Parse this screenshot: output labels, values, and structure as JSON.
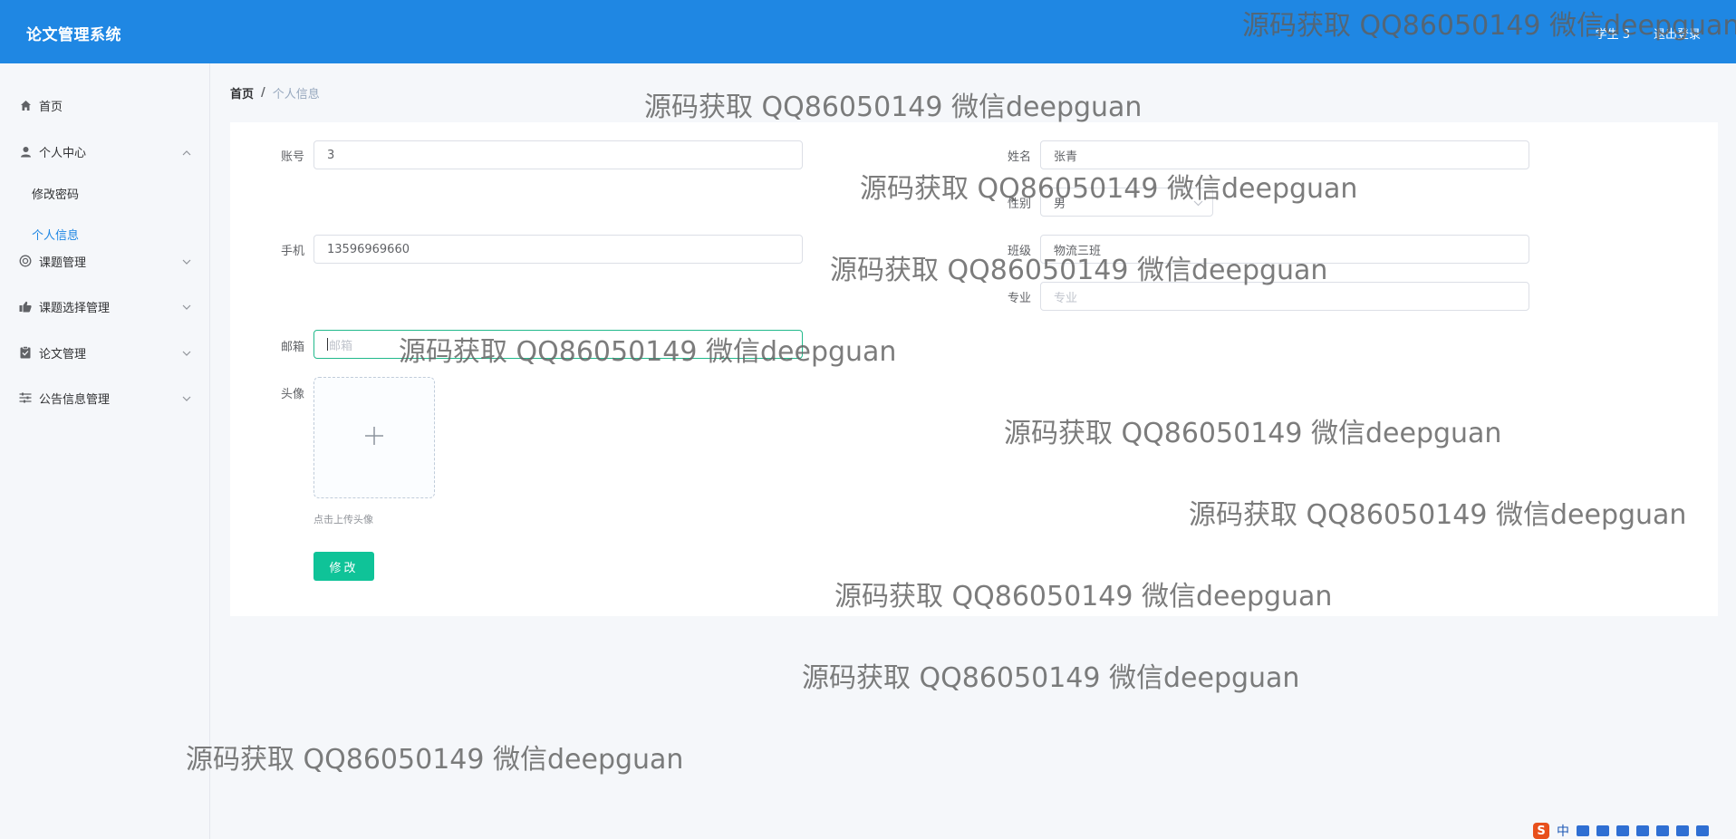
{
  "header": {
    "app_title": "论文管理系统",
    "user_label": "学生 3",
    "logout_label": "退出登录"
  },
  "sidebar": {
    "items": [
      {
        "label": "首页",
        "icon": "home-icon"
      },
      {
        "label": "个人中心",
        "icon": "user-icon",
        "expanded": true,
        "children": [
          {
            "label": "修改密码"
          },
          {
            "label": "个人信息",
            "active": true
          }
        ]
      },
      {
        "label": "课题管理",
        "icon": "topic-icon"
      },
      {
        "label": "课题选择管理",
        "icon": "selection-icon"
      },
      {
        "label": "论文管理",
        "icon": "paper-icon"
      },
      {
        "label": "公告信息管理",
        "icon": "notice-icon"
      }
    ]
  },
  "breadcrumb": {
    "home": "首页",
    "separator": "/",
    "current": "个人信息"
  },
  "form": {
    "account": {
      "label": "账号",
      "value": "3"
    },
    "name": {
      "label": "姓名",
      "value": "张青"
    },
    "gender": {
      "label": "性别",
      "value": "男"
    },
    "phone": {
      "label": "手机",
      "value": "13596969660"
    },
    "class": {
      "label": "班级",
      "value": "物流三班"
    },
    "major": {
      "label": "专业",
      "placeholder": "专业"
    },
    "email": {
      "label": "邮箱",
      "placeholder": "邮箱"
    },
    "avatar": {
      "label": "头像",
      "upload_tip": "点击上传头像",
      "plus": "+"
    },
    "submit_label": "修改"
  },
  "watermark_text": "源码获取 QQ86050149 微信deepguan",
  "tray": {
    "ime_badge": "S",
    "ime_lang": "中"
  },
  "colors": {
    "header_bg": "#1f87e3",
    "active_menu": "#1f87e3",
    "submit_bg": "#0fc398",
    "focus_border": "#21b98b"
  }
}
